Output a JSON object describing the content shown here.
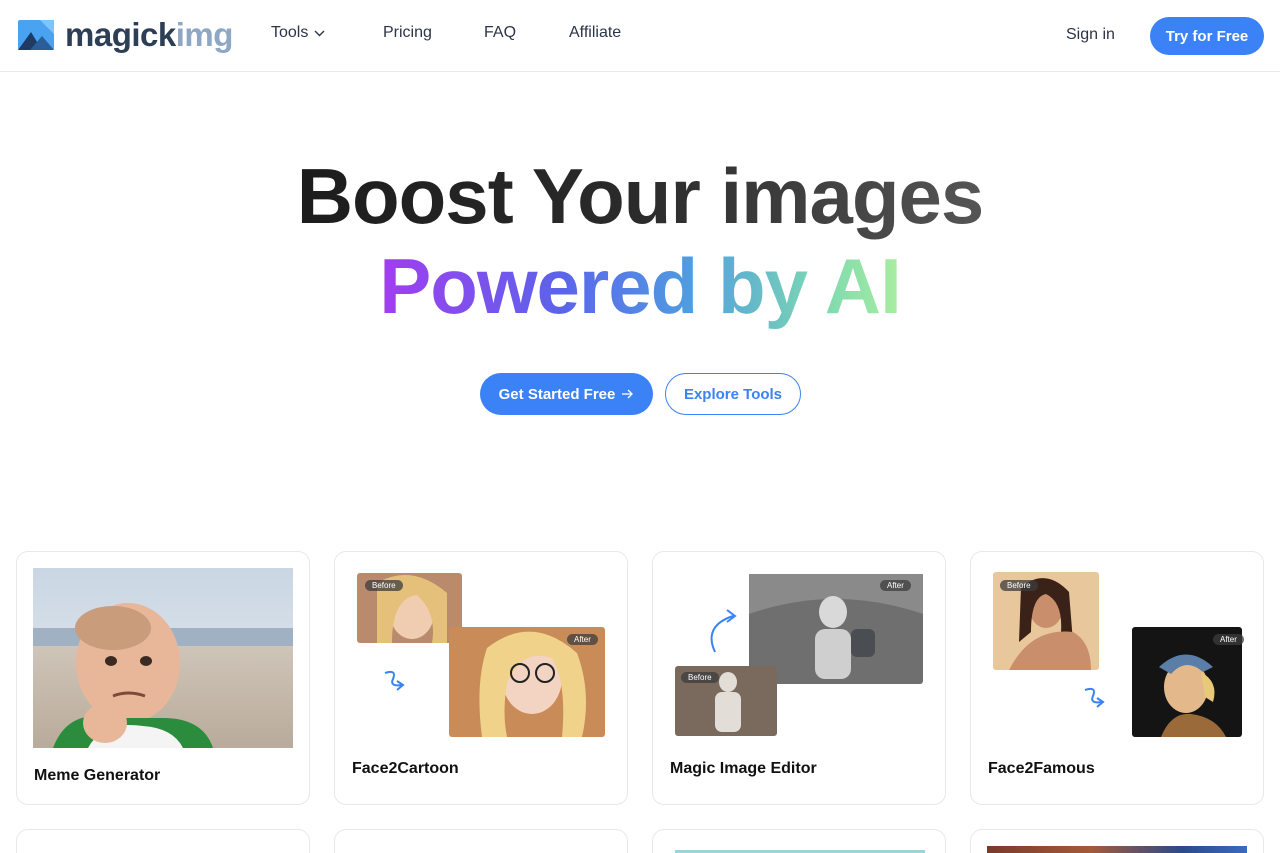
{
  "brand": {
    "name_part1": "magick",
    "name_part2": "img"
  },
  "nav": {
    "tools": "Tools",
    "pricing": "Pricing",
    "faq": "FAQ",
    "affiliate": "Affiliate"
  },
  "auth": {
    "sign_in": "Sign in",
    "try_free": "Try for Free"
  },
  "hero": {
    "line1": "Boost Your images",
    "line2": "Powered by AI",
    "cta_primary": "Get Started Free",
    "cta_secondary": "Explore Tools"
  },
  "cards": [
    {
      "title": "Meme Generator"
    },
    {
      "title": "Face2Cartoon",
      "before": "Before",
      "after": "After"
    },
    {
      "title": "Magic Image Editor",
      "before": "Before",
      "after": "After"
    },
    {
      "title": "Face2Famous",
      "before": "Before",
      "after": "After"
    }
  ],
  "colors": {
    "accent": "#3b82f6",
    "text_dark": "#2b3548"
  },
  "icons": [
    "logo-mountain-icon",
    "chevron-down-icon",
    "arrow-right-icon",
    "curve-arrow-icon"
  ]
}
